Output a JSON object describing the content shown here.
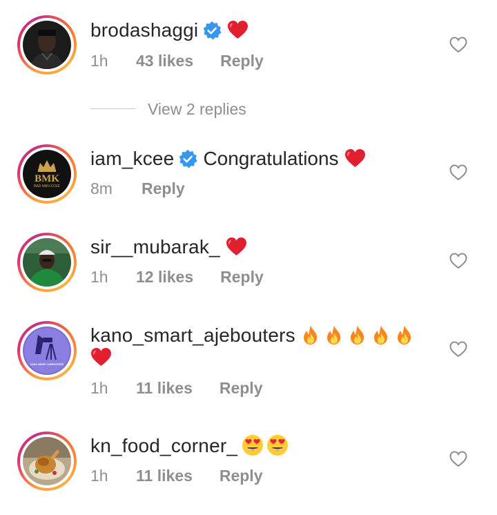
{
  "comments": [
    {
      "username": "brodashaggi",
      "verified": true,
      "text": "",
      "emoji_after": [
        "red-heart"
      ],
      "time": "1h",
      "likes": "43 likes",
      "reply_label": "Reply",
      "avatar_icon": "person-avatar"
    },
    {
      "username": "iam_kcee",
      "verified": true,
      "text": "Congratulations",
      "emoji_after": [
        "red-heart"
      ],
      "time": "8m",
      "likes": "",
      "reply_label": "Reply",
      "avatar_logo_text": "BMK",
      "avatar_logo_subtext": "BAD MAN KCEE"
    },
    {
      "username": "sir__mubarak_",
      "verified": false,
      "text": "",
      "emoji_after": [
        "red-heart"
      ],
      "time": "1h",
      "likes": "12 likes",
      "reply_label": "Reply",
      "avatar_icon": "person-avatar"
    },
    {
      "username": "kano_smart_ajebouters",
      "verified": false,
      "text": "",
      "emoji_after": [
        "fire",
        "fire",
        "fire",
        "fire",
        "fire",
        "red-heart"
      ],
      "time": "1h",
      "likes": "11 likes",
      "reply_label": "Reply",
      "avatar_logo_text": "KANO SMART AJEBOUTERS"
    },
    {
      "username": "kn_food_corner_",
      "verified": false,
      "text": "",
      "emoji_after": [
        "smiling-face-with-heart-eyes",
        "smiling-face-with-heart-eyes"
      ],
      "time": "1h",
      "likes": "11 likes",
      "reply_label": "Reply",
      "avatar_icon": "food-photo"
    }
  ],
  "view_replies_label": "View 2 replies",
  "colors": {
    "text": "#262626",
    "muted": "#8e8e8e",
    "verified_blue": "#3897f0",
    "heart_red": "#e0202e",
    "ring_gradient": [
      "#f9a43c",
      "#e1306c",
      "#c13584"
    ]
  }
}
